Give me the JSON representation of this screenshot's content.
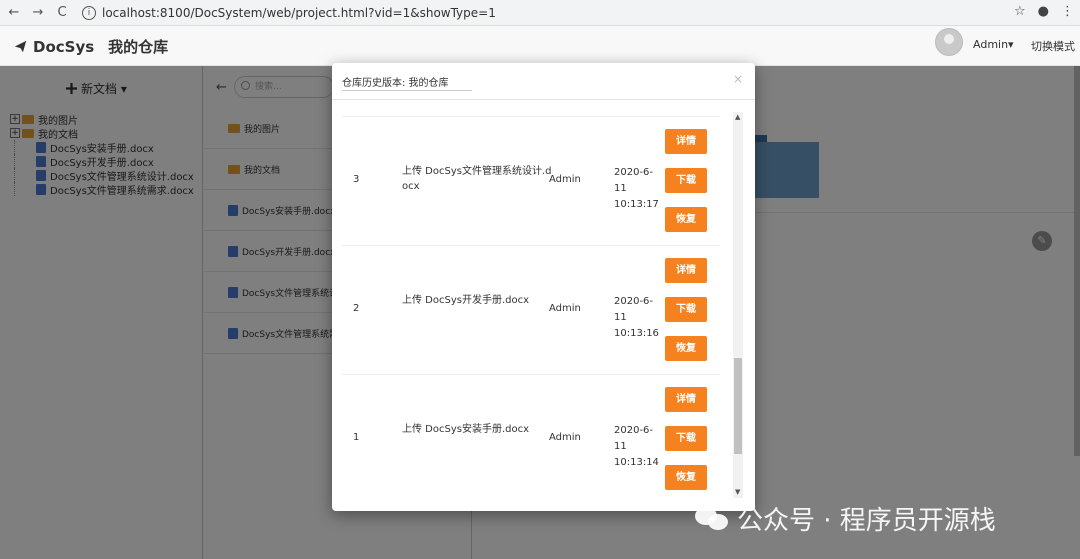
{
  "browser": {
    "back": "←",
    "forward": "→",
    "reload": "C",
    "info": "i",
    "url": "localhost:8100/DocSystem/web/project.html?vid=1&showType=1",
    "star": "☆",
    "profile": "●",
    "menu": "⋮"
  },
  "header": {
    "brand": "DocSys",
    "repo_name": "我的仓库",
    "user": "Admin▾",
    "switch_mode": "切换模式"
  },
  "left": {
    "new_doc": "新文档 ▾",
    "tree": [
      {
        "label": "我的图片",
        "type": "folder"
      },
      {
        "label": "我的文档",
        "type": "folder"
      },
      {
        "label": "DocSys安装手册.docx",
        "type": "doc"
      },
      {
        "label": "DocSys开发手册.docx",
        "type": "doc"
      },
      {
        "label": "DocSys文件管理系统设计.docx",
        "type": "doc"
      },
      {
        "label": "DocSys文件管理系统需求.docx",
        "type": "doc"
      }
    ]
  },
  "middle": {
    "search_placeholder": "搜索...",
    "files": [
      {
        "label": "我的图片",
        "type": "folder"
      },
      {
        "label": "我的文档",
        "type": "folder"
      },
      {
        "label": "DocSys安装手册.docx",
        "type": "doc"
      },
      {
        "label": "DocSys开发手册.docx",
        "type": "doc"
      },
      {
        "label": "DocSys文件管理系统设",
        "type": "doc"
      },
      {
        "label": "DocSys文件管理系统需",
        "type": "doc"
      }
    ]
  },
  "modal": {
    "title": "仓库历史版本: 我的仓库",
    "close": "×",
    "rows": [
      {
        "no": "3",
        "desc": "上传 DocSys文件管理系统设计.docx",
        "user": "Admin",
        "date": "2020-6-11",
        "time": "10:13:17"
      },
      {
        "no": "2",
        "desc": "上传 DocSys开发手册.docx",
        "user": "Admin",
        "date": "2020-6-11",
        "time": "10:13:16"
      },
      {
        "no": "1",
        "desc": "上传 DocSys安装手册.docx",
        "user": "Admin",
        "date": "2020-6-11",
        "time": "10:13:14"
      }
    ],
    "btn_detail": "详情",
    "btn_download": "下载",
    "btn_restore": "恢复",
    "scroll_up": "▲",
    "scroll_down": "▼"
  },
  "watermark": "公众号 · 程序员开源栈",
  "colors": {
    "accent_button": "#f5821f",
    "folder": "#e6a23c",
    "doc": "#4a7bd0"
  }
}
